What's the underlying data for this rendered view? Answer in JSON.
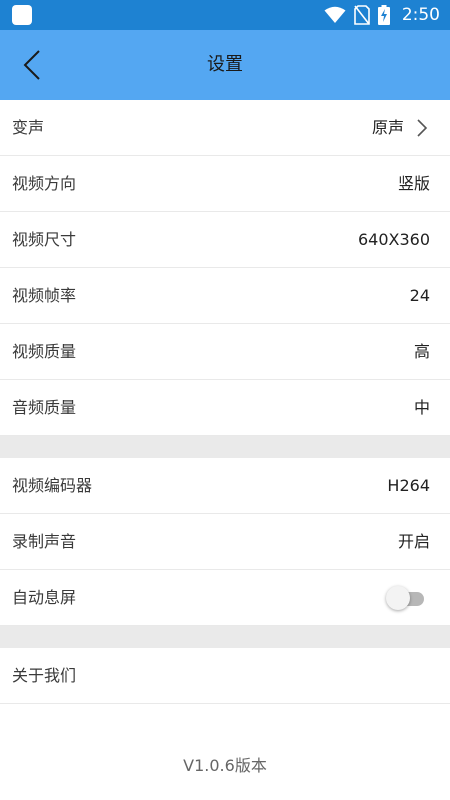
{
  "status_bar": {
    "time": "2:50",
    "icons": [
      "app-notification-icon",
      "wifi-icon",
      "no-sim-icon",
      "battery-charging-icon"
    ],
    "background": "#1e82d2"
  },
  "header": {
    "title": "设置",
    "back_icon": "chevron-left-icon",
    "background": "#54a7f2"
  },
  "group1": {
    "voice_change": {
      "label": "变声",
      "value": "原声",
      "arrow_icon": "chevron-right-icon"
    },
    "video_orientation": {
      "label": "视频方向",
      "value": "竖版"
    },
    "video_size": {
      "label": "视频尺寸",
      "value": "640X360"
    },
    "video_fps": {
      "label": "视频帧率",
      "value": "24"
    },
    "video_quality": {
      "label": "视频质量",
      "value": "高"
    },
    "audio_quality": {
      "label": "音频质量",
      "value": "中"
    }
  },
  "group2": {
    "video_encoder": {
      "label": "视频编码器",
      "value": "H264"
    },
    "record_audio": {
      "label": "录制声音",
      "value": "开启"
    },
    "auto_screen_off": {
      "label": "自动息屏",
      "enabled": false
    }
  },
  "group3": {
    "about_us": {
      "label": "关于我们"
    }
  },
  "footer": {
    "version": "V1.0.6版本"
  }
}
